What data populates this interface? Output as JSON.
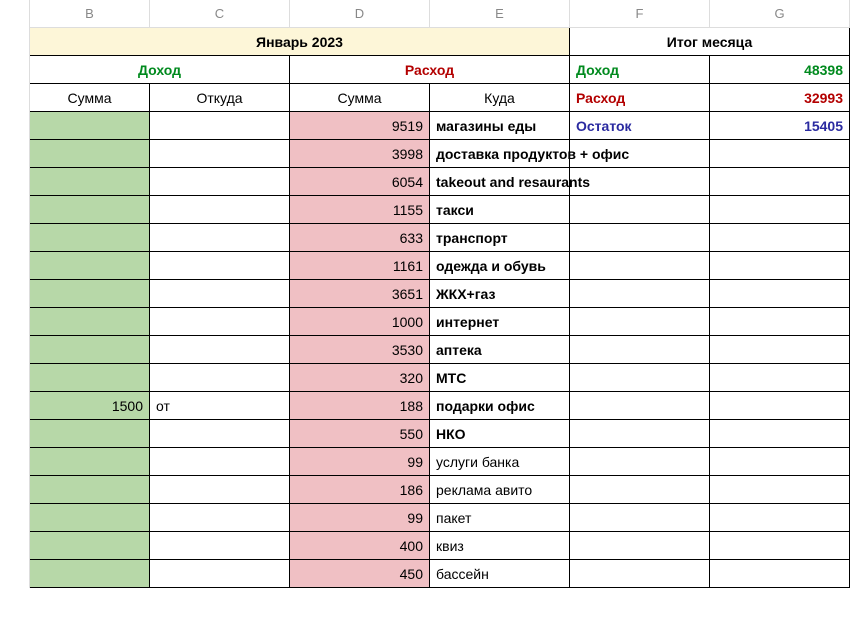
{
  "columns": [
    "B",
    "C",
    "D",
    "E",
    "F",
    "G"
  ],
  "header": {
    "month_title": "Январь 2023",
    "summary_title": "Итог месяца",
    "income_label": "Доход",
    "expense_label": "Расход",
    "sub_sum": "Сумма",
    "sub_from": "Откуда",
    "sub_to": "Куда"
  },
  "summary": {
    "income_label": "Доход",
    "income_value": "48398",
    "expense_label": "Расход",
    "expense_value": "32993",
    "remainder_label": "Остаток",
    "remainder_value": "15405"
  },
  "rows": [
    {
      "income_amount": "",
      "income_from": "",
      "expense_amount": "9519",
      "expense_to": "магазины еды",
      "bold": true
    },
    {
      "income_amount": "",
      "income_from": "",
      "expense_amount": "3998",
      "expense_to": "доставка продуктов + офис",
      "bold": true,
      "overflow": true
    },
    {
      "income_amount": "",
      "income_from": "",
      "expense_amount": "6054",
      "expense_to": "takeout and resaurants",
      "bold": true,
      "overflow": true
    },
    {
      "income_amount": "",
      "income_from": "",
      "expense_amount": "1155",
      "expense_to": "такси",
      "bold": true
    },
    {
      "income_amount": "",
      "income_from": "",
      "expense_amount": "633",
      "expense_to": "транспорт",
      "bold": true
    },
    {
      "income_amount": "",
      "income_from": "",
      "expense_amount": "1161",
      "expense_to": "одежда и обувь",
      "bold": true
    },
    {
      "income_amount": "",
      "income_from": "",
      "expense_amount": "3651",
      "expense_to": "ЖКХ+газ",
      "bold": true
    },
    {
      "income_amount": "",
      "income_from": "",
      "expense_amount": "1000",
      "expense_to": "интернет",
      "bold": true
    },
    {
      "income_amount": "",
      "income_from": "",
      "expense_amount": "3530",
      "expense_to": "аптека",
      "bold": true
    },
    {
      "income_amount": "",
      "income_from": "",
      "expense_amount": "320",
      "expense_to": "МТС",
      "bold": true
    },
    {
      "income_amount": "1500",
      "income_from": "от",
      "expense_amount": "188",
      "expense_to": "подарки офис",
      "bold": true
    },
    {
      "income_amount": "",
      "income_from": "",
      "expense_amount": "550",
      "expense_to": "НКО",
      "bold": true
    },
    {
      "income_amount": "",
      "income_from": "",
      "expense_amount": "99",
      "expense_to": "услуги банка",
      "bold": false
    },
    {
      "income_amount": "",
      "income_from": "",
      "expense_amount": "186",
      "expense_to": "реклама авито",
      "bold": false
    },
    {
      "income_amount": "",
      "income_from": "",
      "expense_amount": "99",
      "expense_to": "пакет",
      "bold": false
    },
    {
      "income_amount": "",
      "income_from": "",
      "expense_amount": "400",
      "expense_to": "квиз",
      "bold": false
    },
    {
      "income_amount": "",
      "income_from": "",
      "expense_amount": "450",
      "expense_to": "бассейн",
      "bold": false
    }
  ]
}
